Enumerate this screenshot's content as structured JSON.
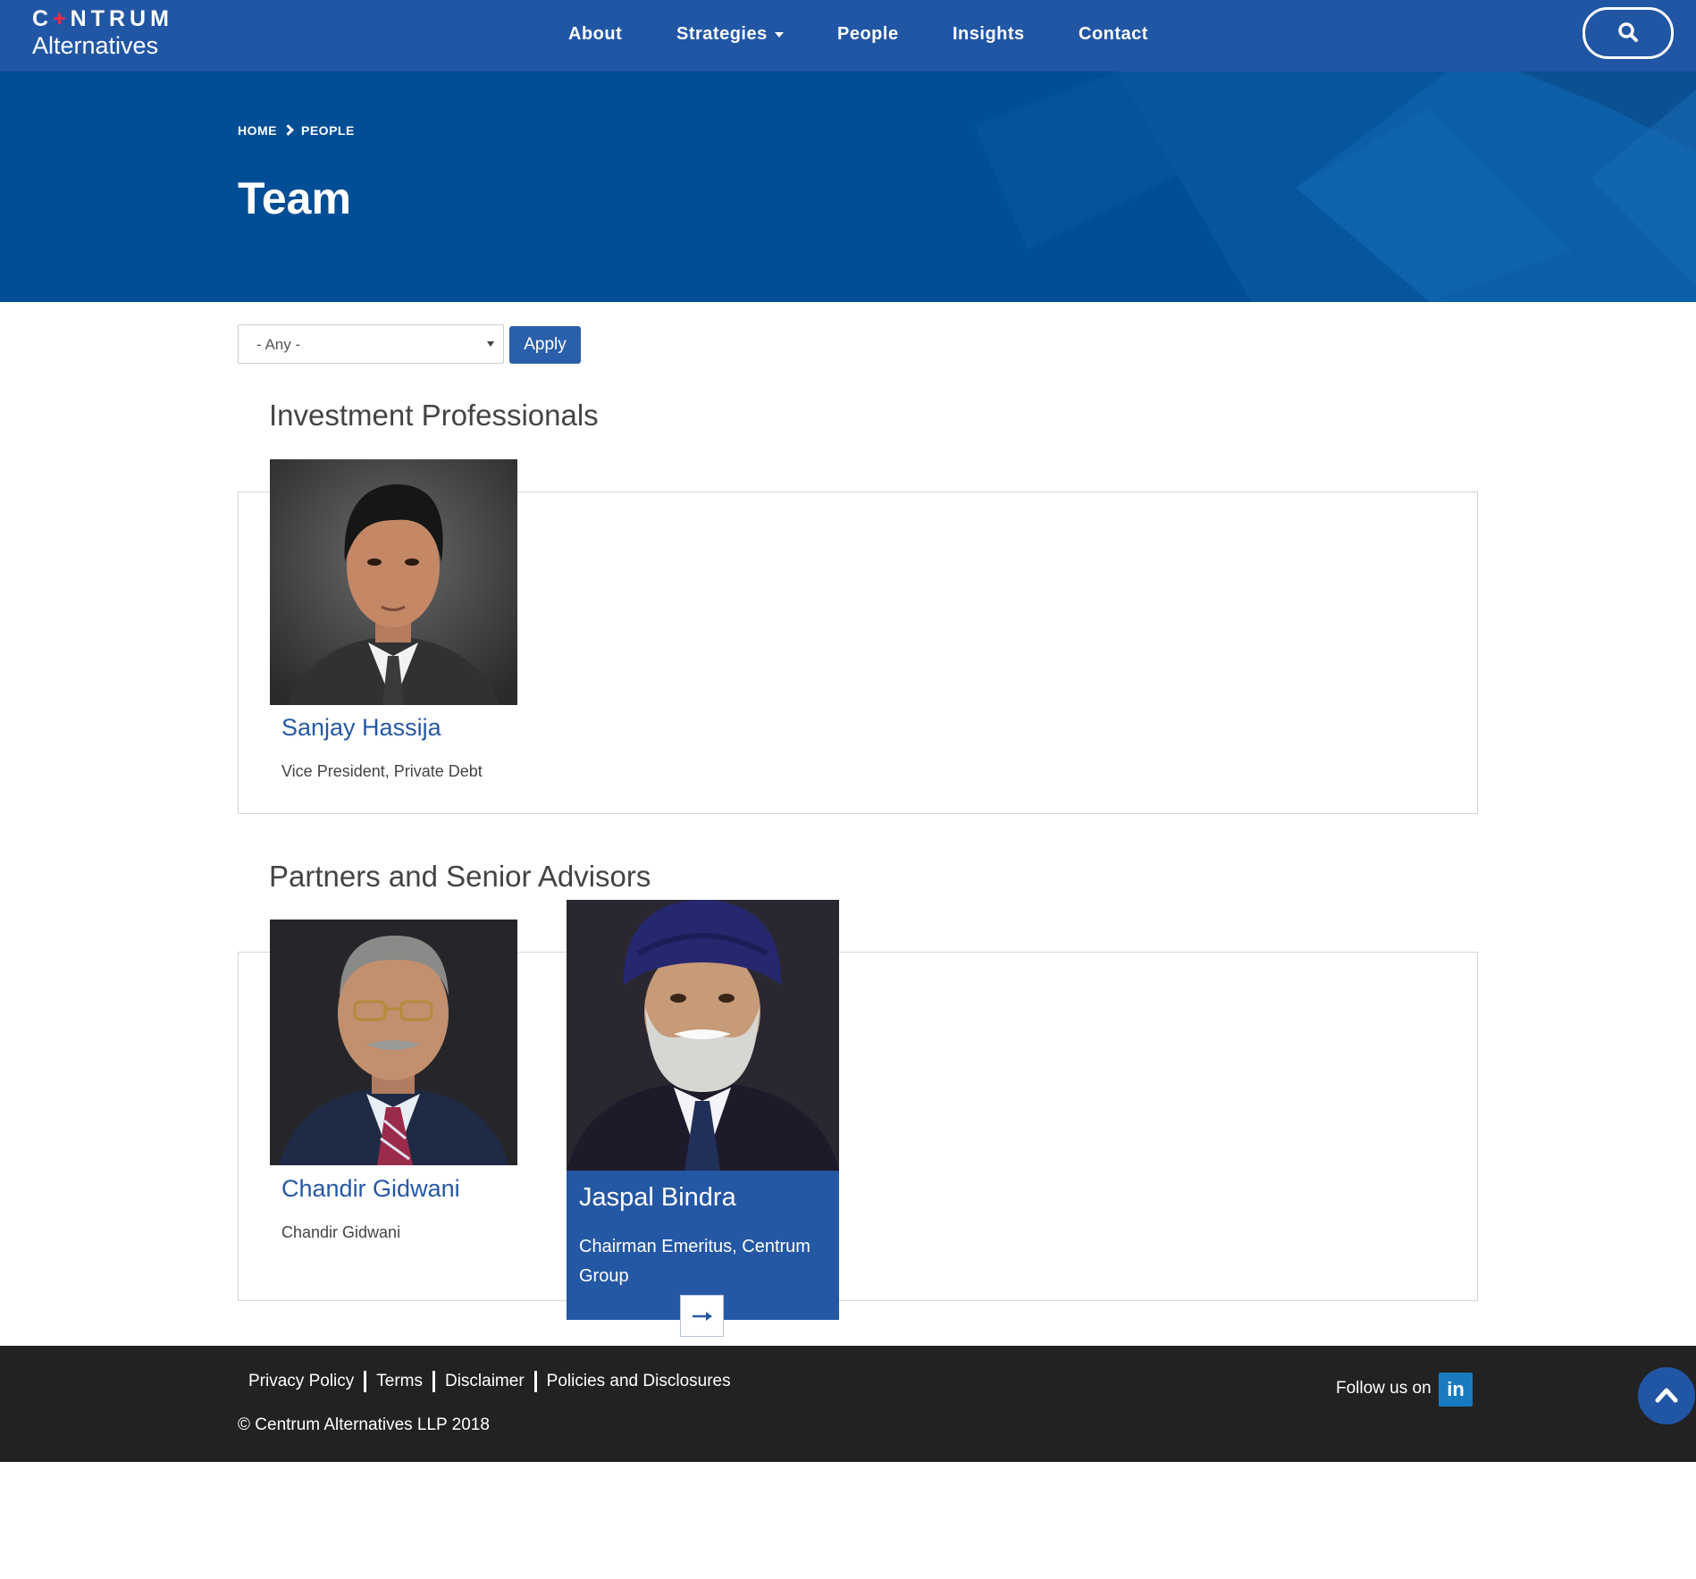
{
  "header": {
    "logo_line1_a": "C",
    "logo_line1_accent": "+",
    "logo_line1_b": "NTRUM",
    "logo_line2": "Alternatives",
    "nav": [
      {
        "label": "About"
      },
      {
        "label": "Strategies"
      },
      {
        "label": "People"
      },
      {
        "label": "Insights"
      },
      {
        "label": "Contact"
      }
    ],
    "search_icon": "search-icon"
  },
  "hero": {
    "breadcrumb": [
      {
        "label": "HOME"
      },
      {
        "label": "PEOPLE"
      }
    ],
    "title": "Team"
  },
  "filter": {
    "selected": "- Any -",
    "apply_label": "Apply"
  },
  "sections": [
    {
      "title": "Investment Professionals",
      "people": [
        {
          "name": "Sanjay Hassija",
          "role": "Vice President, Private Debt"
        }
      ]
    },
    {
      "title": "Partners and Senior Advisors",
      "people": [
        {
          "name": "Chandir Gidwani",
          "role": "Chandir Gidwani"
        },
        {
          "name": "Jaspal Bindra",
          "role": "Chairman Emeritus, Centrum Group"
        }
      ]
    }
  ],
  "footer": {
    "links": [
      {
        "label": "Privacy Policy"
      },
      {
        "label": "Terms"
      },
      {
        "label": "Disclaimer"
      },
      {
        "label": "Policies and Disclosures"
      }
    ],
    "copyright": "© Centrum Alternatives LLP 2018",
    "follow_label": "Follow us on",
    "social_text": "in"
  },
  "colors": {
    "brand_blue": "#2156a5",
    "hero_blue": "#004e95",
    "footer_bg": "#222222",
    "accent_red": "#e4343c"
  }
}
